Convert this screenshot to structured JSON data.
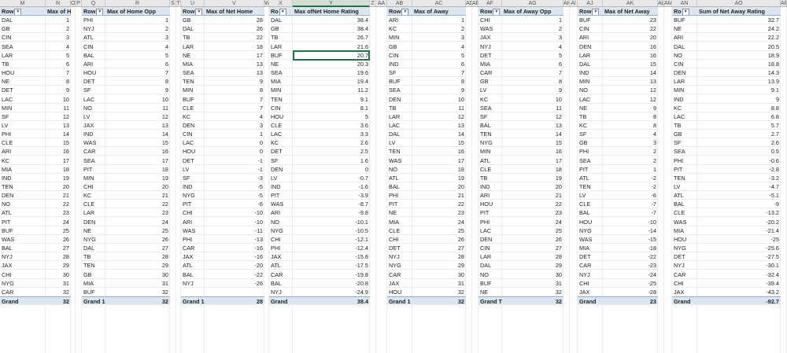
{
  "column_headers": [
    "M",
    "N",
    "O",
    "P",
    "Q",
    "R",
    "S",
    "T",
    "U",
    "V",
    "W",
    "X",
    "Y",
    "Z",
    "AA",
    "AB",
    "AC",
    "AD",
    "AE",
    "AF",
    "AG",
    "AH",
    "AI",
    "AJ",
    "AK",
    "AL",
    "AM",
    "AN",
    "AO",
    "AP"
  ],
  "selected_column": "Y",
  "selected_value": "20.7",
  "tables": [
    {
      "row_header": "Row",
      "value_header": "Max of Home",
      "grand_label": "Grand",
      "grand_value": "32",
      "rows": [
        [
          "DAL",
          "1"
        ],
        [
          "GB",
          "2"
        ],
        [
          "CIN",
          "3"
        ],
        [
          "SEA",
          "4"
        ],
        [
          "LAR",
          "5"
        ],
        [
          "TB",
          "6"
        ],
        [
          "HOU",
          "7"
        ],
        [
          "NE",
          "8"
        ],
        [
          "DET",
          "9"
        ],
        [
          "LAC",
          "10"
        ],
        [
          "MIN",
          "11"
        ],
        [
          "SF",
          "12"
        ],
        [
          "LV",
          "13"
        ],
        [
          "PHI",
          "14"
        ],
        [
          "CLE",
          "15"
        ],
        [
          "ARI",
          "16"
        ],
        [
          "KC",
          "17"
        ],
        [
          "MIA",
          "18"
        ],
        [
          "IND",
          "19"
        ],
        [
          "TEN",
          "20"
        ],
        [
          "DEN",
          "21"
        ],
        [
          "NO",
          "22"
        ],
        [
          "ATL",
          "23"
        ],
        [
          "PIT",
          "24"
        ],
        [
          "BUF",
          "25"
        ],
        [
          "WAS",
          "26"
        ],
        [
          "BAL",
          "27"
        ],
        [
          "NYJ",
          "28"
        ],
        [
          "JAX",
          "29"
        ],
        [
          "CHI",
          "30"
        ],
        [
          "NYG",
          "31"
        ],
        [
          "CAR",
          "32"
        ]
      ]
    },
    {
      "row_header": "Row",
      "value_header": "Max of Home Opp",
      "grand_label": "Grand 1",
      "grand_value": "32",
      "rows": [
        [
          "PHI",
          "1"
        ],
        [
          "NYJ",
          "2"
        ],
        [
          "ATL",
          "3"
        ],
        [
          "CIN",
          "4"
        ],
        [
          "BAL",
          "5"
        ],
        [
          "ARI",
          "6"
        ],
        [
          "HOU",
          "7"
        ],
        [
          "DET",
          "8"
        ],
        [
          "SF",
          "9"
        ],
        [
          "LAC",
          "10"
        ],
        [
          "NO",
          "11"
        ],
        [
          "LV",
          "12"
        ],
        [
          "JAX",
          "13"
        ],
        [
          "IND",
          "14"
        ],
        [
          "WAS",
          "15"
        ],
        [
          "CAR",
          "16"
        ],
        [
          "SEA",
          "17"
        ],
        [
          "PIT",
          "18"
        ],
        [
          "MIN",
          "19"
        ],
        [
          "CHI",
          "20"
        ],
        [
          "KC",
          "21"
        ],
        [
          "CLE",
          "22"
        ],
        [
          "LAR",
          "23"
        ],
        [
          "DEN",
          "24"
        ],
        [
          "NE",
          "25"
        ],
        [
          "NYG",
          "26"
        ],
        [
          "DAL",
          "27"
        ],
        [
          "TB",
          "28"
        ],
        [
          "TEN",
          "29"
        ],
        [
          "GB",
          "30"
        ],
        [
          "MIA",
          "31"
        ],
        [
          "BUF",
          "32"
        ]
      ]
    },
    {
      "row_header": "Row",
      "value_header": "Max of Net Home",
      "grand_label": "Grand 1",
      "grand_value": "28",
      "rows": [
        [
          "GB",
          "28"
        ],
        [
          "DAL",
          "26"
        ],
        [
          "TB",
          "22"
        ],
        [
          "LAR",
          "18"
        ],
        [
          "NE",
          "17"
        ],
        [
          "MIA",
          "13"
        ],
        [
          "SEA",
          "13"
        ],
        [
          "TEN",
          "9"
        ],
        [
          "MIN",
          "8"
        ],
        [
          "BUF",
          "7"
        ],
        [
          "CLE",
          "7"
        ],
        [
          "KC",
          "4"
        ],
        [
          "DEN",
          "3"
        ],
        [
          "CIN",
          "1"
        ],
        [
          "LAC",
          "0"
        ],
        [
          "HOU",
          "0"
        ],
        [
          "DET",
          "-1"
        ],
        [
          "LV",
          "-1"
        ],
        [
          "SF",
          "-3"
        ],
        [
          "IND",
          "-5"
        ],
        [
          "NYG",
          "-5"
        ],
        [
          "PIT",
          "-6"
        ],
        [
          "CHI",
          "-10"
        ],
        [
          "ARI",
          "-10"
        ],
        [
          "WAS",
          "-11"
        ],
        [
          "PHI",
          "-13"
        ],
        [
          "CAR",
          "-16"
        ],
        [
          "JAX",
          "-16"
        ],
        [
          "ATL",
          "-20"
        ],
        [
          "BAL",
          "-22"
        ],
        [
          "NYJ",
          "-26"
        ]
      ]
    },
    {
      "row_header": "Ro",
      "value_header": "Max ofNet Home Rating",
      "grand_label": "Grand",
      "grand_value": "38.4",
      "rows": [
        [
          "DAL",
          "38.4"
        ],
        [
          "GB",
          "38.4"
        ],
        [
          "TB",
          "26.7"
        ],
        [
          "LAR",
          "21.6"
        ],
        [
          "BUF",
          "20.7"
        ],
        [
          "NE",
          "20.3"
        ],
        [
          "SEA",
          "19.6"
        ],
        [
          "MIA",
          "19.4"
        ],
        [
          "MIN",
          "11.2"
        ],
        [
          "TEN",
          "9.1"
        ],
        [
          "CIN",
          "8.1"
        ],
        [
          "HOU",
          "5"
        ],
        [
          "CLE",
          "3.6"
        ],
        [
          "LAC",
          "3.3"
        ],
        [
          "KC",
          "2.6"
        ],
        [
          "DET",
          "2.5"
        ],
        [
          "SF",
          "1.6"
        ],
        [
          "DEN",
          "0"
        ],
        [
          "LV",
          "-0.7"
        ],
        [
          "IND",
          "-1.6"
        ],
        [
          "PIT",
          "-3.9"
        ],
        [
          "WAS",
          "-8.7"
        ],
        [
          "ARI",
          "-9.8"
        ],
        [
          "NO",
          "-10.1"
        ],
        [
          "NYG",
          "-10.5"
        ],
        [
          "CHI",
          "-12.1"
        ],
        [
          "PHI",
          "-12.4"
        ],
        [
          "JAX",
          "-15.8"
        ],
        [
          "ATL",
          "-17.5"
        ],
        [
          "CAR",
          "-19.8"
        ],
        [
          "BAL",
          "-20.8"
        ],
        [
          "NYJ",
          "-24.9"
        ]
      ]
    },
    {
      "row_header": "Row",
      "value_header": "Max of Away",
      "grand_label": "Grand 1",
      "grand_value": "32",
      "rows": [
        [
          "ARI",
          "1"
        ],
        [
          "KC",
          "2"
        ],
        [
          "MIN",
          "3"
        ],
        [
          "GB",
          "4"
        ],
        [
          "CIN",
          "5"
        ],
        [
          "IND",
          "6"
        ],
        [
          "SF",
          "7"
        ],
        [
          "BUF",
          "8"
        ],
        [
          "SEA",
          "9"
        ],
        [
          "DEN",
          "10"
        ],
        [
          "TB",
          "11"
        ],
        [
          "LAR",
          "12"
        ],
        [
          "LAC",
          "13"
        ],
        [
          "DAL",
          "14"
        ],
        [
          "LV",
          "15"
        ],
        [
          "TEN",
          "16"
        ],
        [
          "WAS",
          "17"
        ],
        [
          "NO",
          "18"
        ],
        [
          "ATL",
          "19"
        ],
        [
          "BAL",
          "20"
        ],
        [
          "PHI",
          "21"
        ],
        [
          "PIT",
          "22"
        ],
        [
          "NE",
          "23"
        ],
        [
          "MIA",
          "24"
        ],
        [
          "CLE",
          "25"
        ],
        [
          "CHI",
          "26"
        ],
        [
          "DET",
          "27"
        ],
        [
          "NYJ",
          "28"
        ],
        [
          "NYG",
          "29"
        ],
        [
          "CAR",
          "30"
        ],
        [
          "JAX",
          "31"
        ],
        [
          "HOU",
          "32"
        ]
      ]
    },
    {
      "row_header": "Row",
      "value_header": "Max of Away Opp",
      "grand_label": "Grand T",
      "grand_value": "32",
      "rows": [
        [
          "CHI",
          "1"
        ],
        [
          "WAS",
          "2"
        ],
        [
          "JAX",
          "3"
        ],
        [
          "NYJ",
          "4"
        ],
        [
          "DET",
          "5"
        ],
        [
          "MIA",
          "6"
        ],
        [
          "CAR",
          "7"
        ],
        [
          "GB",
          "8"
        ],
        [
          "LV",
          "9"
        ],
        [
          "KC",
          "10"
        ],
        [
          "SEA",
          "11"
        ],
        [
          "SF",
          "12"
        ],
        [
          "BAL",
          "13"
        ],
        [
          "TEN",
          "14"
        ],
        [
          "NYG",
          "15"
        ],
        [
          "MIN",
          "16"
        ],
        [
          "ATL",
          "17"
        ],
        [
          "CLE",
          "18"
        ],
        [
          "TB",
          "19"
        ],
        [
          "IND",
          "20"
        ],
        [
          "ARI",
          "21"
        ],
        [
          "HOU",
          "22"
        ],
        [
          "PIT",
          "23"
        ],
        [
          "PHI",
          "24"
        ],
        [
          "LAC",
          "25"
        ],
        [
          "DEN",
          "26"
        ],
        [
          "CIN",
          "27"
        ],
        [
          "LAR",
          "28"
        ],
        [
          "DAL",
          "29"
        ],
        [
          "NO",
          "30"
        ],
        [
          "BUF",
          "31"
        ],
        [
          "NE",
          "32"
        ]
      ]
    },
    {
      "row_header": "Row",
      "value_header": "Max of Net Away",
      "grand_label": "Grand",
      "grand_value": "23",
      "rows": [
        [
          "BUF",
          "23"
        ],
        [
          "CIN",
          "22"
        ],
        [
          "ARI",
          "20"
        ],
        [
          "DEN",
          "16"
        ],
        [
          "LAR",
          "16"
        ],
        [
          "DAL",
          "15"
        ],
        [
          "IND",
          "14"
        ],
        [
          "MIN",
          "13"
        ],
        [
          "NO",
          "12"
        ],
        [
          "LAC",
          "12"
        ],
        [
          "NE",
          "9"
        ],
        [
          "TB",
          "8"
        ],
        [
          "KC",
          "8"
        ],
        [
          "SF",
          "4"
        ],
        [
          "GB",
          "3"
        ],
        [
          "PHI",
          "2"
        ],
        [
          "SEA",
          "2"
        ],
        [
          "PIT",
          "1"
        ],
        [
          "ATL",
          "-2"
        ],
        [
          "TEN",
          "-2"
        ],
        [
          "LV",
          "-6"
        ],
        [
          "CLE",
          "-7"
        ],
        [
          "BAL",
          "-7"
        ],
        [
          "HOU",
          "-10"
        ],
        [
          "NYG",
          "-14"
        ],
        [
          "WAS",
          "-15"
        ],
        [
          "MIA",
          "-18"
        ],
        [
          "DET",
          "-22"
        ],
        [
          "CAR",
          "-23"
        ],
        [
          "NYJ",
          "-24"
        ],
        [
          "CHI",
          "-25"
        ],
        [
          "JAX",
          "-28"
        ]
      ]
    },
    {
      "row_header": "Ro",
      "value_header": "Sum of Net Away Rating",
      "grand_label": "Grand",
      "grand_value": "-92.7",
      "rows": [
        [
          "BUF",
          "32.7"
        ],
        [
          "NE",
          "24.2"
        ],
        [
          "ARI",
          "22.2"
        ],
        [
          "DAL",
          "20.5"
        ],
        [
          "NO",
          "18.9"
        ],
        [
          "CIN",
          "18.8"
        ],
        [
          "DEN",
          "14.3"
        ],
        [
          "LAR",
          "13.9"
        ],
        [
          "MIN",
          "9.1"
        ],
        [
          "IND",
          "9"
        ],
        [
          "KC",
          "8.8"
        ],
        [
          "LAC",
          "6.8"
        ],
        [
          "TB",
          "5.7"
        ],
        [
          "GB",
          "2.7"
        ],
        [
          "SF",
          "2.6"
        ],
        [
          "SEA",
          "0.5"
        ],
        [
          "PHI",
          "-0.6"
        ],
        [
          "PIT",
          "-2.8"
        ],
        [
          "TEN",
          "-3.2"
        ],
        [
          "LV",
          "-4.7"
        ],
        [
          "ATL",
          "-5.1"
        ],
        [
          "BAL",
          "-9"
        ],
        [
          "CLE",
          "-13.2"
        ],
        [
          "WAS",
          "-20.2"
        ],
        [
          "MIA",
          "-21.4"
        ],
        [
          "HOU",
          "-25"
        ],
        [
          "NYG",
          "-25.6"
        ],
        [
          "DET",
          "-27.5"
        ],
        [
          "NYJ",
          "-30.1"
        ],
        [
          "CAR",
          "-32.4"
        ],
        [
          "CHI",
          "-39.4"
        ],
        [
          "JAX",
          "-43.2"
        ]
      ]
    }
  ]
}
